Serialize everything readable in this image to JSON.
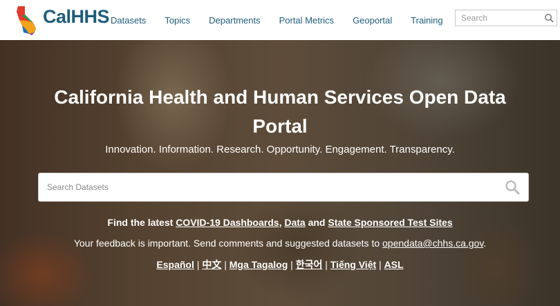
{
  "brand": {
    "name": "CalHHS"
  },
  "nav": {
    "items": [
      "Datasets",
      "Topics",
      "Departments",
      "Portal Metrics",
      "Geoportal",
      "Training"
    ]
  },
  "header_search": {
    "placeholder": "Search"
  },
  "hero": {
    "title": "California Health and Human Services Open Data Portal",
    "tagline": "Innovation. Information. Research. Opportunity. Engagement. Transparency.",
    "search_placeholder": "Search Datasets",
    "latest": {
      "prefix": "Find the latest ",
      "covid_link": "COVID-19 Dashboards",
      "sep1": ", ",
      "data_link": "Data",
      "sep2": " and ",
      "testsites_link": "State Sponsored Test Sites"
    },
    "feedback": {
      "text": "Your feedback is important. Send comments and suggested datasets to ",
      "email": "opendata@chhs.ca.gov",
      "end": "."
    },
    "languages": [
      "Español",
      "中文",
      "Mga Tagalog",
      "한국어",
      "Tiếng Việt",
      "ASL"
    ],
    "lang_sep": " | "
  },
  "colors": {
    "nav_text": "#1f5c7a",
    "logo_text": "#1f5c7a",
    "hero_text": "#ffffff"
  }
}
